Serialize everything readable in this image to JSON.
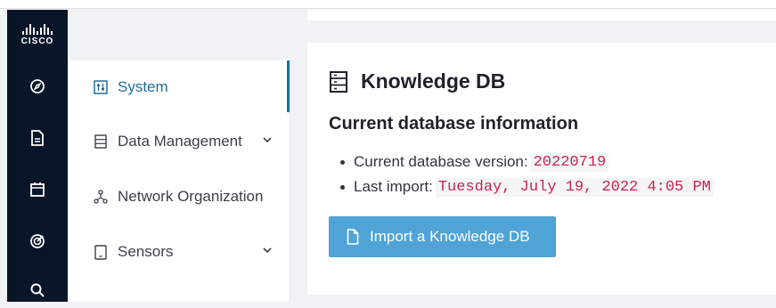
{
  "brand": {
    "logo_text": "CISCO"
  },
  "rail": {
    "icons": [
      "compass-icon",
      "document-icon",
      "calendar-icon",
      "target-icon",
      "search-icon"
    ]
  },
  "menu": {
    "items": [
      {
        "label": "System",
        "icon": "sliders-icon",
        "active": true,
        "has_chevron": false
      },
      {
        "label": "Data Management",
        "icon": "server-icon",
        "active": false,
        "has_chevron": true
      },
      {
        "label": "Network Organization",
        "icon": "network-icon",
        "active": false,
        "has_chevron": false
      },
      {
        "label": "Sensors",
        "icon": "tablet-icon",
        "active": false,
        "has_chevron": true
      }
    ]
  },
  "main": {
    "title": "Knowledge DB",
    "subtitle": "Current database information",
    "version_label": "Current database version:",
    "version_value": "20220719",
    "import_label": "Last import:",
    "import_value": "Tuesday, July 19, 2022 4:05 PM",
    "button_label": "Import a Knowledge DB"
  },
  "colors": {
    "rail_bg": "#09162a",
    "accent": "#1f6f9a",
    "button_bg": "#4fa3d6",
    "code_text": "#c7254e"
  }
}
